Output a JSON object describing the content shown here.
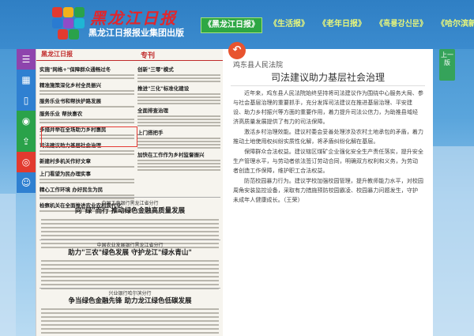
{
  "header": {
    "logo_title": "黑龙江日报",
    "logo_subtitle": "黑龙江日报报业集团出版",
    "logo_colors": [
      "#e23a2f",
      "#f2b21b",
      "#2aa24a",
      "#2a7bd1",
      "#8f4cc8",
      "#1fb6d4"
    ],
    "tabs": [
      {
        "label": "《黑龙江日报》",
        "active": true
      },
      {
        "label": "《生活报》",
        "active": false
      },
      {
        "label": "《老年日报》",
        "active": false
      },
      {
        "label": "《흑룡강신문》",
        "active": false
      },
      {
        "label": "《哈尔滨新闻》",
        "active": false
      }
    ]
  },
  "sidebar": {
    "buttons": [
      {
        "icon": "menu-icon",
        "color": "#8e44ad"
      },
      {
        "icon": "grid-icon",
        "color": "#2f80d1"
      },
      {
        "icon": "phone-icon",
        "color": "#2f80d1"
      },
      {
        "icon": "wechat-icon",
        "color": "#2aa24a"
      },
      {
        "icon": "share-icon",
        "color": "#2aa24a"
      },
      {
        "icon": "weibo-icon",
        "color": "#e23a2f"
      },
      {
        "icon": "qq-icon",
        "color": "#2f80d1"
      }
    ]
  },
  "paper": {
    "masthead": "黑龙江日报",
    "section": "专刊",
    "left_headlines": [
      "实施\"网格+\"保障群众通畅过冬",
      "创新\"三零\"模式",
      "推进\"三化\"标准化建设",
      "精准施策深化乡村全员振兴",
      "服务乐业 帮扶惠农",
      "多措并举在全场助力乡村惠民",
      "服务乐业书和帮扶护路发展",
      "司法建议助力基层社会治理",
      "新建村多机关作好文章",
      "全面排查治理",
      "上门搭把手",
      "上门看望为民办理实事",
      "精心工作环境 办好民生为民",
      "检察机关在全面推进农业农村现代化",
      "加快在工作作为乡村监督振兴"
    ],
    "story1": {
      "kicker": "中国工商银行黑龙江省分行",
      "headline": "向\"绿\"而行 推动绿色金融高质量发展"
    },
    "story2": {
      "kicker": "中国农业发展银行黑龙江省分行",
      "headline": "助力\"三农\"绿色发展 守护龙江\"绿水青山\""
    },
    "story3": {
      "kicker": "兴业银行哈尔滨分行",
      "headline": "争当绿色金融先锋 助力龙江绿色低碳发展"
    }
  },
  "article": {
    "source": "鸡东县人民法院",
    "title": "司法建议助力基层社会治理",
    "paragraphs": [
      "近年来，鸡东县人民法院始终坚持将司法建议作为围绕中心服务大局、参与社会基层治理的重要抓手，充分发挥司法建议在推进基层治理、平安建设、助力乡村振兴等方面的重要作用，着力提升司法公信力，为助推县域经济高质量发展提供了有力的司法保障。",
      "激活乡村治理效能。建议村委会妥善处理涉及农村土地承包的矛盾，着力推动土地使用权纠纷实质性化解，将矛盾纠纷化解在基层。",
      "保障群众合法权益。建议辖区煤矿企业强化安全生产责任落实，提升安全生产管理水平，与劳动者依法签订劳动合同，明确双方权利和义务，为劳动者创造工作保障，维护职工合法权益。",
      "防范校园暴力行为。建议学校加强校园管理，提升教师能力水平，对校园周角安装监控设备，采取有力措施预防校园霸凌、校园暴力问题发生，守护未成年人健康成长。（王荣）"
    ]
  },
  "page_nav": {
    "label": "上一版"
  }
}
